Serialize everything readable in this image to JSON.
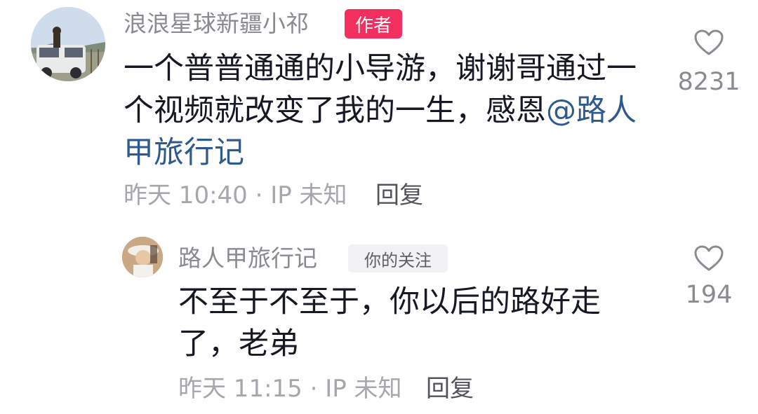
{
  "comment": {
    "username": "浪浪星球新疆小祁",
    "author_badge": "作者",
    "text_line1": "一个普普通通的小导游，谢谢哥通过一",
    "text_line2": "个视频就改变了我的一生，感恩",
    "mention_line2": "@路人",
    "mention_line3": "甲旅行记",
    "meta": "昨天 10:40 · IP 未知",
    "reply_label": "回复",
    "like_count": "8231"
  },
  "reply": {
    "username": "路人甲旅行记",
    "follow_badge": "你的关注",
    "text_line1": "不至于不至于，你以后的路好走",
    "text_line2": "了，老弟",
    "meta": "昨天 11:15 · IP 未知",
    "reply_label": "回复",
    "like_count": "194"
  },
  "icons": {
    "like": "heart-outline-icon"
  },
  "colors": {
    "author_badge_bg": "#f22f5f",
    "mention": "#2f5a8f",
    "meta": "#a6a7ad"
  }
}
